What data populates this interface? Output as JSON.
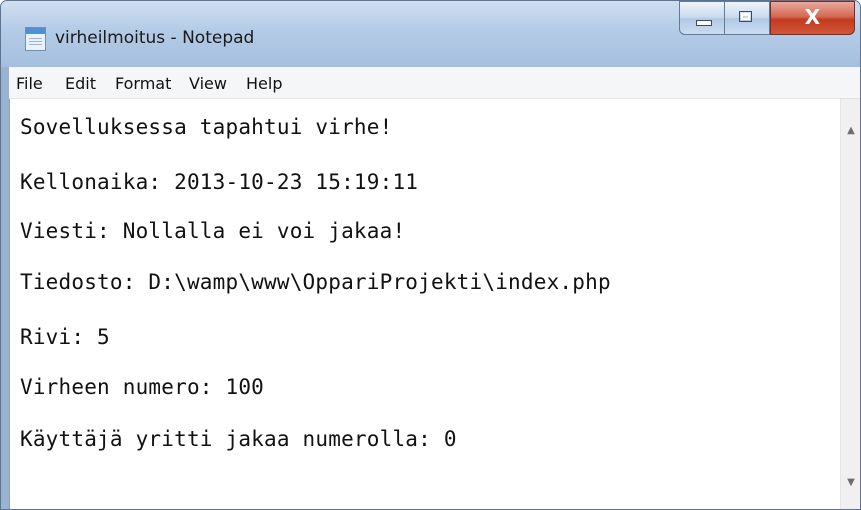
{
  "window": {
    "title": "virheilmoitus - Notepad",
    "icon": "notepad-icon"
  },
  "caption_buttons": {
    "minimize_icon": "minimize-icon",
    "maximize_icon": "maximize-icon",
    "close_symbol": "X"
  },
  "menu": {
    "items": [
      "File",
      "Edit",
      "Format",
      "View",
      "Help"
    ]
  },
  "document": {
    "lines": [
      "Sovelluksessa tapahtui virhe!",
      "Kellonaika: 2013-10-23 15:19:11",
      "Viesti: Nollalla ei voi jakaa!",
      "Tiedosto: D:\\wamp\\www\\OppariProjekti\\index.php",
      "Rivi: 5",
      "Virheen numero: 100",
      "Käyttäjä yritti jakaa numerolla: 0"
    ]
  },
  "scrollbar": {
    "up_arrow": "▲",
    "down_arrow": "▼"
  },
  "colors": {
    "titlebar": "#b4cbe6",
    "close_button": "#c23b1f",
    "menubar": "#f5f6f7",
    "editor_bg": "#ffffff"
  }
}
